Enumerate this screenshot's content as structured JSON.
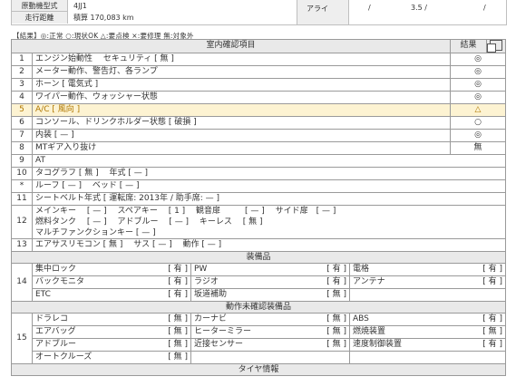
{
  "top": {
    "rows": [
      {
        "key": "原動機型式",
        "value": "4JJ1"
      },
      {
        "key": "走行距離",
        "value": "積算 170,083 km"
      }
    ],
    "tire_label": "アライ",
    "tire_v1": "/",
    "tire_v2": "3.5 /",
    "tire_v3": "/"
  },
  "legend": "【結果】◎:正常 ○:現状OK △:要点検 ×:要修理 無:対象外",
  "header": {
    "title": "室内確認項目",
    "result": "結果",
    "icon": "copy-icon"
  },
  "rows": [
    {
      "no": "1",
      "text": "エンジン始動性　 セキュリティ [ 無 ]",
      "result": "◎"
    },
    {
      "no": "2",
      "text": "メーター動作、警告灯、各ランプ",
      "result": "◎"
    },
    {
      "no": "3",
      "text": "ホーン [ 電気式 ]",
      "result": "◎"
    },
    {
      "no": "4",
      "text": "ワイパー動作、ウォッシャー状態",
      "result": "◎"
    },
    {
      "no": "5",
      "text": "A/C [ 風向 ]",
      "result": "△"
    },
    {
      "no": "6",
      "text": "コンソール、ドリンクホルダー状態 [ 破損 ]",
      "result": "○"
    },
    {
      "no": "7",
      "text": "内装 [ — ]",
      "result": "◎"
    },
    {
      "no": "8",
      "text": "MTギア入り抜け",
      "result": "無"
    },
    {
      "no": "9",
      "text": "AT",
      "result": ""
    },
    {
      "no": "10",
      "text": "タコグラフ [ 無 ]　 年式 [ — ]",
      "result": ""
    },
    {
      "no": "*",
      "text": "ルーフ [ — ]　 ベッド [ — ]",
      "result": ""
    },
    {
      "no": "11",
      "text": "シートベルト年式 [ 運転席: 2013年 / 助手席: — ]",
      "result": ""
    },
    {
      "no": "12",
      "lines": [
        "メインキー　 [ — ]　 スペアキー　 [ 1 ]　 観音扉　　　[ — ]　 サイド扉　[ — ]",
        "燃料タンク　 [ — ]　 アドブルー　 [ — ]　 キーレス　 [ 無 ]",
        "マルチファンクションキー [ — ]"
      ],
      "result": ""
    },
    {
      "no": "13",
      "text": "エアサスリモコン [ 無 ]　 サス [ — ]　 動作 [ — ]",
      "result": ""
    }
  ],
  "equipment": {
    "title": "装備品",
    "no": "14",
    "items": [
      [
        {
          "label": "集中ロック",
          "value": "[ 有 ]"
        },
        {
          "label": "PW",
          "value": "[ 有 ]"
        },
        {
          "label": "電格",
          "value": "[ 有 ]"
        }
      ],
      [
        {
          "label": "バックモニタ",
          "value": "[ 有 ]"
        },
        {
          "label": "ラジオ",
          "value": "[ 有 ]"
        },
        {
          "label": "アンテナ",
          "value": "[ 有 ]"
        }
      ],
      [
        {
          "label": "ETC",
          "value": "[ 有 ]"
        },
        {
          "label": "坂道補助",
          "value": "[ 無 ]"
        },
        {
          "label": "",
          "value": ""
        }
      ]
    ]
  },
  "unconfirmed": {
    "title": "動作未確認装備品",
    "no": "15",
    "items": [
      [
        {
          "label": "ドラレコ",
          "value": "[ 無 ]"
        },
        {
          "label": "カーナビ",
          "value": "[ 無 ]"
        },
        {
          "label": "ABS",
          "value": "[ 有 ]"
        }
      ],
      [
        {
          "label": "エアバッグ",
          "value": "[ 無 ]"
        },
        {
          "label": "ヒーターミラー",
          "value": "[ 無 ]"
        },
        {
          "label": "燃焼装置",
          "value": "[ 無 ]"
        }
      ],
      [
        {
          "label": "アドブルー",
          "value": "[ 無 ]"
        },
        {
          "label": "近接センサー",
          "value": "[ 無 ]"
        },
        {
          "label": "速度制御装置",
          "value": "[ 有 ]"
        }
      ],
      [
        {
          "label": "オートクルーズ",
          "value": "[ 無 ]"
        },
        {
          "label": "",
          "value": ""
        },
        {
          "label": "",
          "value": ""
        }
      ]
    ]
  },
  "footer_title": "タイヤ情報"
}
